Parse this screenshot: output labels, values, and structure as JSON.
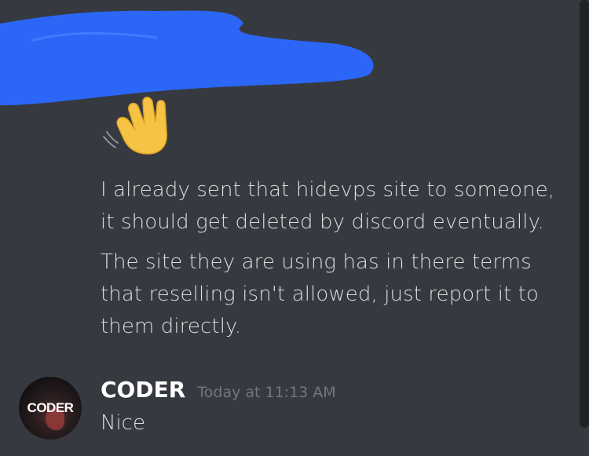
{
  "colors": {
    "background": "#36393f",
    "message_text": "#dcddde",
    "username": "#ffffff",
    "timestamp": "#72767d",
    "redaction": "#2b66f6",
    "scrollbar": "#202225"
  },
  "icons": {
    "redaction": "redaction-scribble",
    "emoji": "waving-hand-emoji"
  },
  "messages": [
    {
      "text": "I already sent that hidevps site to someone, it should get deleted by discord eventually."
    },
    {
      "text": "The site they are using has in there terms that reselling isn't allowed, just report it to them directly."
    }
  ],
  "reply": {
    "avatar_text": "CODER",
    "username": "CODER",
    "timestamp": "Today at 11:13 AM",
    "text": "Nice"
  }
}
